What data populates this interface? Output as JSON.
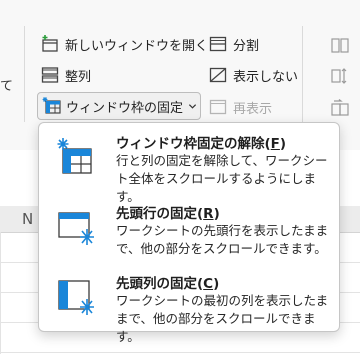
{
  "ribbon": {
    "left_fragment": "て",
    "new_window": "新しいウィンドウを開く",
    "split": "分割",
    "arrange": "整列",
    "hide": "表示しない",
    "freeze_panes": "ウィンドウ枠の固定",
    "unhide": "再表示"
  },
  "sheet": {
    "column_letter": "N"
  },
  "menu": {
    "items": [
      {
        "title": "ウィンドウ枠固定の解除(F)",
        "title_pre": "ウィンドウ枠固定の解除(",
        "title_key": "F",
        "title_post": ")",
        "description": "行と列の固定を解除して、ワークシート全体をスクロールするようにします。",
        "icon": "unfreeze-panes-icon"
      },
      {
        "title": "先頭行の固定(R)",
        "title_pre": "先頭行の固定(",
        "title_key": "R",
        "title_post": ")",
        "description": "ワークシートの先頭行を表示したままで、他の部分をスクロールできます。",
        "icon": "freeze-top-row-icon"
      },
      {
        "title": "先頭列の固定(C)",
        "title_pre": "先頭列の固定(",
        "title_key": "C",
        "title_post": ")",
        "description": "ワークシートの最初の列を表示したままで、他の部分をスクロールできます。",
        "icon": "freeze-first-column-icon"
      }
    ]
  },
  "colors": {
    "accent_blue": "#1a86d9",
    "icon_gray": "#444444",
    "disabled": "#a8a8a8"
  }
}
